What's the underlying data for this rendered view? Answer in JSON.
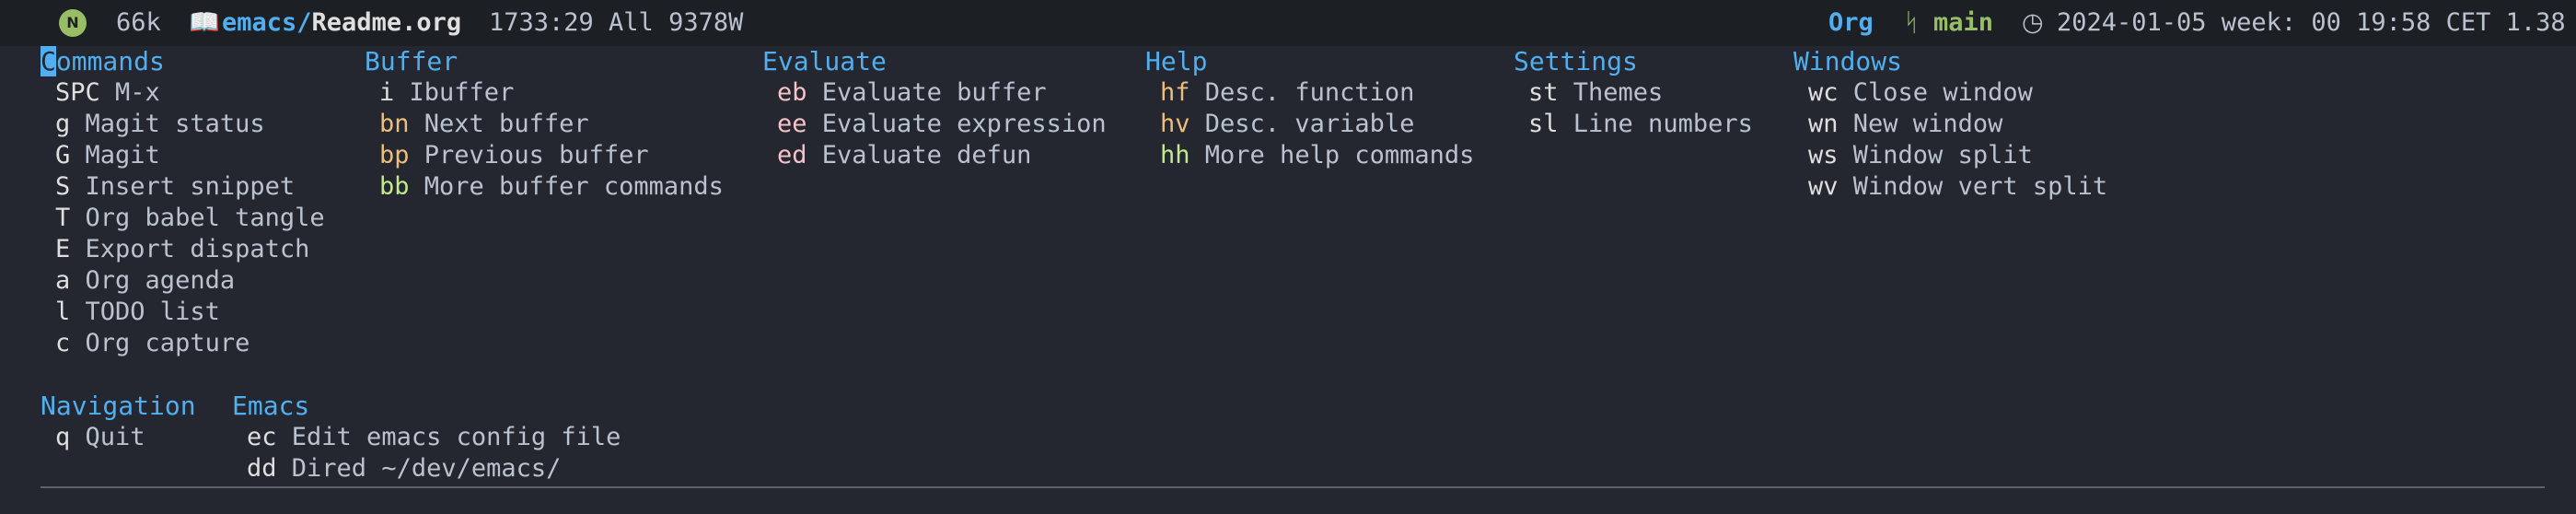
{
  "modeline": {
    "badge": "N",
    "size": "66k",
    "dir": "emacs/",
    "filename": "Readme.org",
    "position": "1733:29 All 9378W",
    "major_mode": "Org",
    "branch": "main",
    "datetime": "2024-01-05 week: 00 19:58 CET 1.38"
  },
  "menu": {
    "groups": [
      {
        "title": "Commands",
        "entries": [
          {
            "key": "SPC",
            "label": "M-x"
          },
          {
            "key": "g",
            "label": "Magit status"
          },
          {
            "key": "G",
            "label": "Magit"
          },
          {
            "key": "S",
            "label": "Insert snippet"
          },
          {
            "key": "T",
            "label": "Org babel tangle"
          },
          {
            "key": "E",
            "label": "Export dispatch"
          },
          {
            "key": "a",
            "label": "Org agenda"
          },
          {
            "key": "l",
            "label": "TODO list"
          },
          {
            "key": "c",
            "label": "Org capture"
          }
        ]
      },
      {
        "title": "Buffer",
        "entries": [
          {
            "key": "i",
            "label": "Ibuffer"
          },
          {
            "key": "bn",
            "label": "Next buffer"
          },
          {
            "key": "bp",
            "label": "Previous buffer"
          },
          {
            "key": "bb",
            "label": "More buffer commands"
          }
        ]
      },
      {
        "title": "Evaluate",
        "entries": [
          {
            "key": "eb",
            "label": "Evaluate buffer"
          },
          {
            "key": "ee",
            "label": "Evaluate expression"
          },
          {
            "key": "ed",
            "label": "Evaluate defun"
          }
        ]
      },
      {
        "title": "Help",
        "entries": [
          {
            "key": "hf",
            "label": "Desc. function"
          },
          {
            "key": "hv",
            "label": "Desc. variable"
          },
          {
            "key": "hh",
            "label": "More help commands"
          }
        ]
      },
      {
        "title": "Settings",
        "entries": [
          {
            "key": "st",
            "label": "Themes"
          },
          {
            "key": "sl",
            "label": "Line numbers"
          }
        ]
      },
      {
        "title": "Windows",
        "entries": [
          {
            "key": "wc",
            "label": "Close window"
          },
          {
            "key": "wn",
            "label": "New window"
          },
          {
            "key": "ws",
            "label": "Window split"
          },
          {
            "key": "wv",
            "label": "Window vert split"
          }
        ]
      },
      {
        "title": "Navigation",
        "entries": [
          {
            "key": "q",
            "label": "Quit"
          }
        ]
      },
      {
        "title": "Emacs",
        "entries": [
          {
            "key": "ec",
            "label": "Edit emacs config file"
          },
          {
            "key": "dd",
            "label": "Dired ~/dev/emacs/"
          }
        ]
      }
    ]
  }
}
